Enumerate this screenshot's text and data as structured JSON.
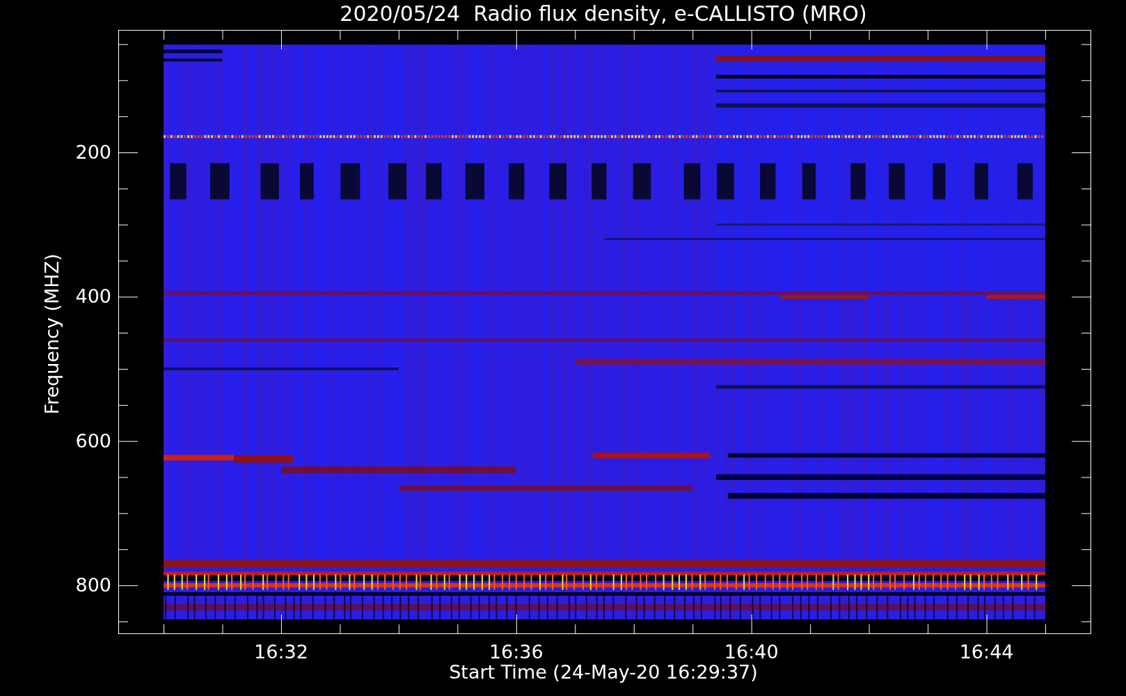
{
  "title": "2020/05/24  Radio flux density, e-CALLISTO (MRO)",
  "y_axis": {
    "title": "Frequency (MHZ)",
    "tick_labels": [
      "200",
      "400",
      "600",
      "800"
    ]
  },
  "x_axis": {
    "title": "Start Time (24-May-20 16:29:37)",
    "tick_labels": [
      "16:32",
      "16:36",
      "16:40",
      "16:44"
    ]
  }
}
